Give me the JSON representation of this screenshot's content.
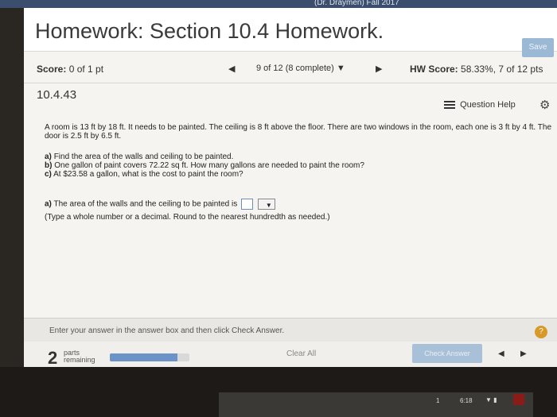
{
  "browser": {
    "tab_title": "(Dr. Draymen) Fall 2017"
  },
  "header": {
    "title": "Homework: Section 10.4 Homework.",
    "save_label": "Save"
  },
  "score_row": {
    "score_label": "Score:",
    "score_value": "0 of 1 pt",
    "question_nav": "9 of 12 (8 complete)",
    "question_nav_dropdown": "▼",
    "prev_icon": "◀",
    "next_icon": "▶",
    "hw_score_label": "HW Score:",
    "hw_score_value": "58.33%, 7 of 12 pts"
  },
  "question": {
    "number": "10.4.43",
    "help_label": "Question Help",
    "problem_text": "A room is 13 ft by 18 ft. It needs to be painted. The ceiling is 8 ft above the floor. There are two windows in the room, each one is 3 ft by 4 ft. The door is 2.5 ft by 6.5 ft.",
    "parts": [
      {
        "tag": "a)",
        "text": "Find the area of the walls and ceiling to be painted."
      },
      {
        "tag": "b)",
        "text": "One gallon of paint covers 72.22 sq ft. How many gallons are needed to paint the room?"
      },
      {
        "tag": "c)",
        "text": "At $23.58 a gallon, what is the cost to paint the room?"
      }
    ],
    "answer_tag": "a)",
    "answer_text": "The area of the walls and the ceiling to be painted is",
    "answer_value": "",
    "unit_dropdown_icon": "▼",
    "answer_hint": "(Type a whole number or a decimal. Round to the nearest hundredth as needed.)"
  },
  "footer": {
    "instruction": "Enter your answer in the answer box and then click Check Answer.",
    "help_icon": "?",
    "parts_count": "2",
    "parts_label_line1": "parts",
    "parts_label_line2": "remaining",
    "progress_fraction": 0.85,
    "clear_all": "Clear All",
    "check_answer": "Check Answer",
    "prev_icon": "◀",
    "next_icon": "▶"
  },
  "taskbar": {
    "number": "1",
    "time": "6:18",
    "icons": "▼ ▮"
  },
  "colors": {
    "accent_blue": "#6c93c7",
    "save_button": "#9bb9d4",
    "help_orange": "#d79a28"
  }
}
